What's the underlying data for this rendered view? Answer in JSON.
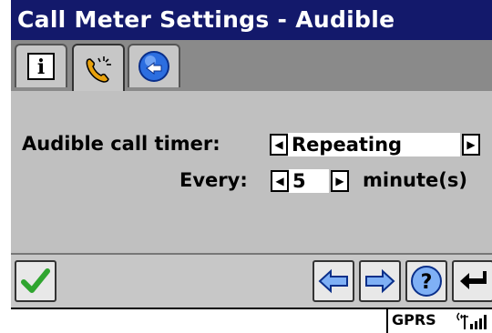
{
  "window": {
    "title": "Call Meter Settings - Audible"
  },
  "tabs": [
    {
      "name": "info",
      "icon": "info-icon",
      "active": false
    },
    {
      "name": "call-meter",
      "icon": "phone-clock-icon",
      "active": true
    },
    {
      "name": "back",
      "icon": "back-globe-icon",
      "active": false
    }
  ],
  "form": {
    "timer_label": "Audible call timer:",
    "timer_value": "Repeating",
    "every_label": "Every:",
    "every_value": "5",
    "unit_label": "minute(s)"
  },
  "toolbar": {
    "ok_icon": "checkmark-icon",
    "prev_icon": "arrow-left-icon",
    "next_icon": "arrow-right-icon",
    "help_icon": "help-icon",
    "back_icon": "return-icon",
    "help_glyph": "?"
  },
  "status": {
    "network": "GPRS"
  },
  "colors": {
    "title_bg": "#13196b",
    "panel_bg": "#c0c0c0",
    "accent_blue": "#3a6bd8",
    "ok_green": "#2fa52f"
  }
}
